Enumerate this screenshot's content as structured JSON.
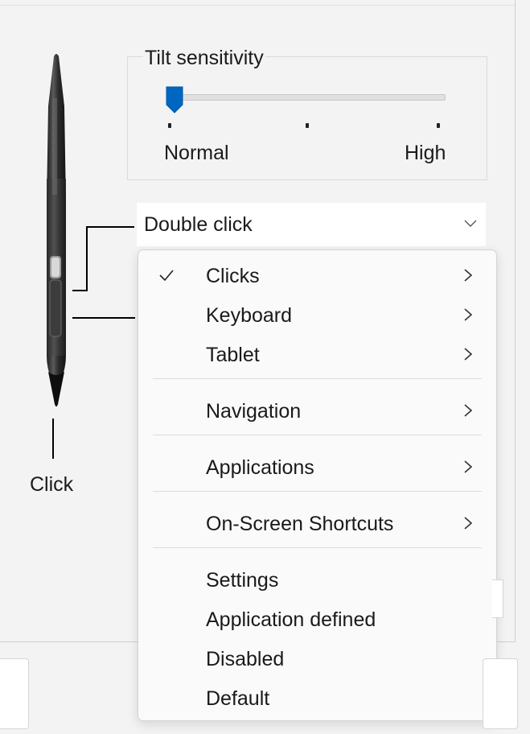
{
  "pen": {
    "button_label": "Click"
  },
  "tilt": {
    "title": "Tilt sensitivity",
    "min_label": "Normal",
    "max_label": "High",
    "level": 0
  },
  "dropdown": {
    "selected": "Double click"
  },
  "menu": {
    "groups": [
      [
        {
          "label": "Clicks",
          "checked": true,
          "submenu": true
        },
        {
          "label": "Keyboard",
          "checked": false,
          "submenu": true
        },
        {
          "label": "Tablet",
          "checked": false,
          "submenu": true
        }
      ],
      [
        {
          "label": "Navigation",
          "checked": false,
          "submenu": true
        }
      ],
      [
        {
          "label": "Applications",
          "checked": false,
          "submenu": true
        }
      ],
      [
        {
          "label": "On-Screen Shortcuts",
          "checked": false,
          "submenu": true
        }
      ],
      [
        {
          "label": "Settings",
          "checked": false,
          "submenu": false
        },
        {
          "label": "Application defined",
          "checked": false,
          "submenu": false
        },
        {
          "label": "Disabled",
          "checked": false,
          "submenu": false
        },
        {
          "label": "Default",
          "checked": false,
          "submenu": false
        }
      ]
    ]
  },
  "colors": {
    "accent": "#0067c0",
    "menu_bg": "#fafafa",
    "window_bg": "#f3f3f3"
  }
}
